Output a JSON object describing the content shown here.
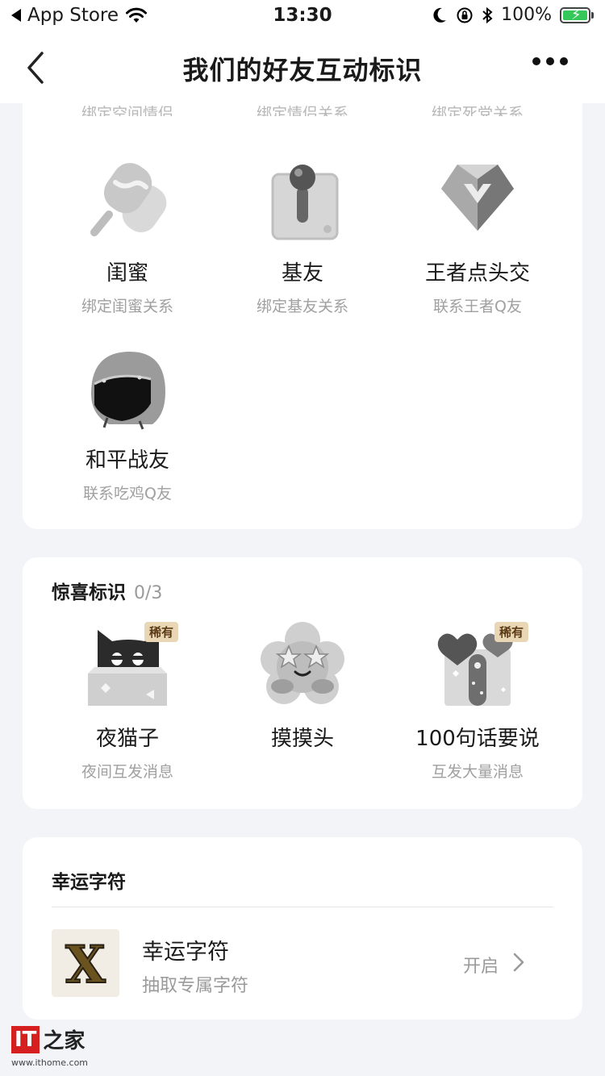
{
  "status_bar": {
    "back_app": "App Store",
    "time": "13:30",
    "battery": "100%"
  },
  "nav": {
    "title": "我们的好友互动标识"
  },
  "top_section": {
    "cut_row": [
      "绑定空间情侣",
      "绑定情侣关系",
      "绑定死党关系"
    ],
    "items": [
      {
        "name": "闺蜜",
        "desc": "绑定闺蜜关系",
        "icon": "popsicle-icon"
      },
      {
        "name": "基友",
        "desc": "绑定基友关系",
        "icon": "joystick-icon"
      },
      {
        "name": "王者点头交",
        "desc": "联系王者Q友",
        "icon": "diamond-icon"
      },
      {
        "name": "和平战友",
        "desc": "联系吃鸡Q友",
        "icon": "helmet-icon"
      }
    ]
  },
  "surprise_section": {
    "title": "惊喜标识",
    "count": "0/3",
    "rare_label": "稀有",
    "items": [
      {
        "name": "夜猫子",
        "desc": "夜间互发消息",
        "icon": "night-cat-icon",
        "rare": true
      },
      {
        "name": "摸摸头",
        "desc": "",
        "icon": "flower-face-icon",
        "rare": false
      },
      {
        "name": "100句话要说",
        "desc": "互发大量消息",
        "icon": "hearts-gift-icon",
        "rare": true
      }
    ]
  },
  "lucky_section": {
    "title": "幸运字符",
    "item": {
      "name": "幸运字符",
      "desc": "抽取专属字符",
      "action": "开启",
      "thumb_letter": "X"
    }
  },
  "watermark": {
    "brand": "IT",
    "brand_zh": "之家",
    "url": "www.ithome.com"
  },
  "colors": {
    "background": "#f3f4f8",
    "card": "#ffffff",
    "rare_tag": "#e8d6b4",
    "battery": "#35c759",
    "watermark_red": "#d6201f"
  }
}
